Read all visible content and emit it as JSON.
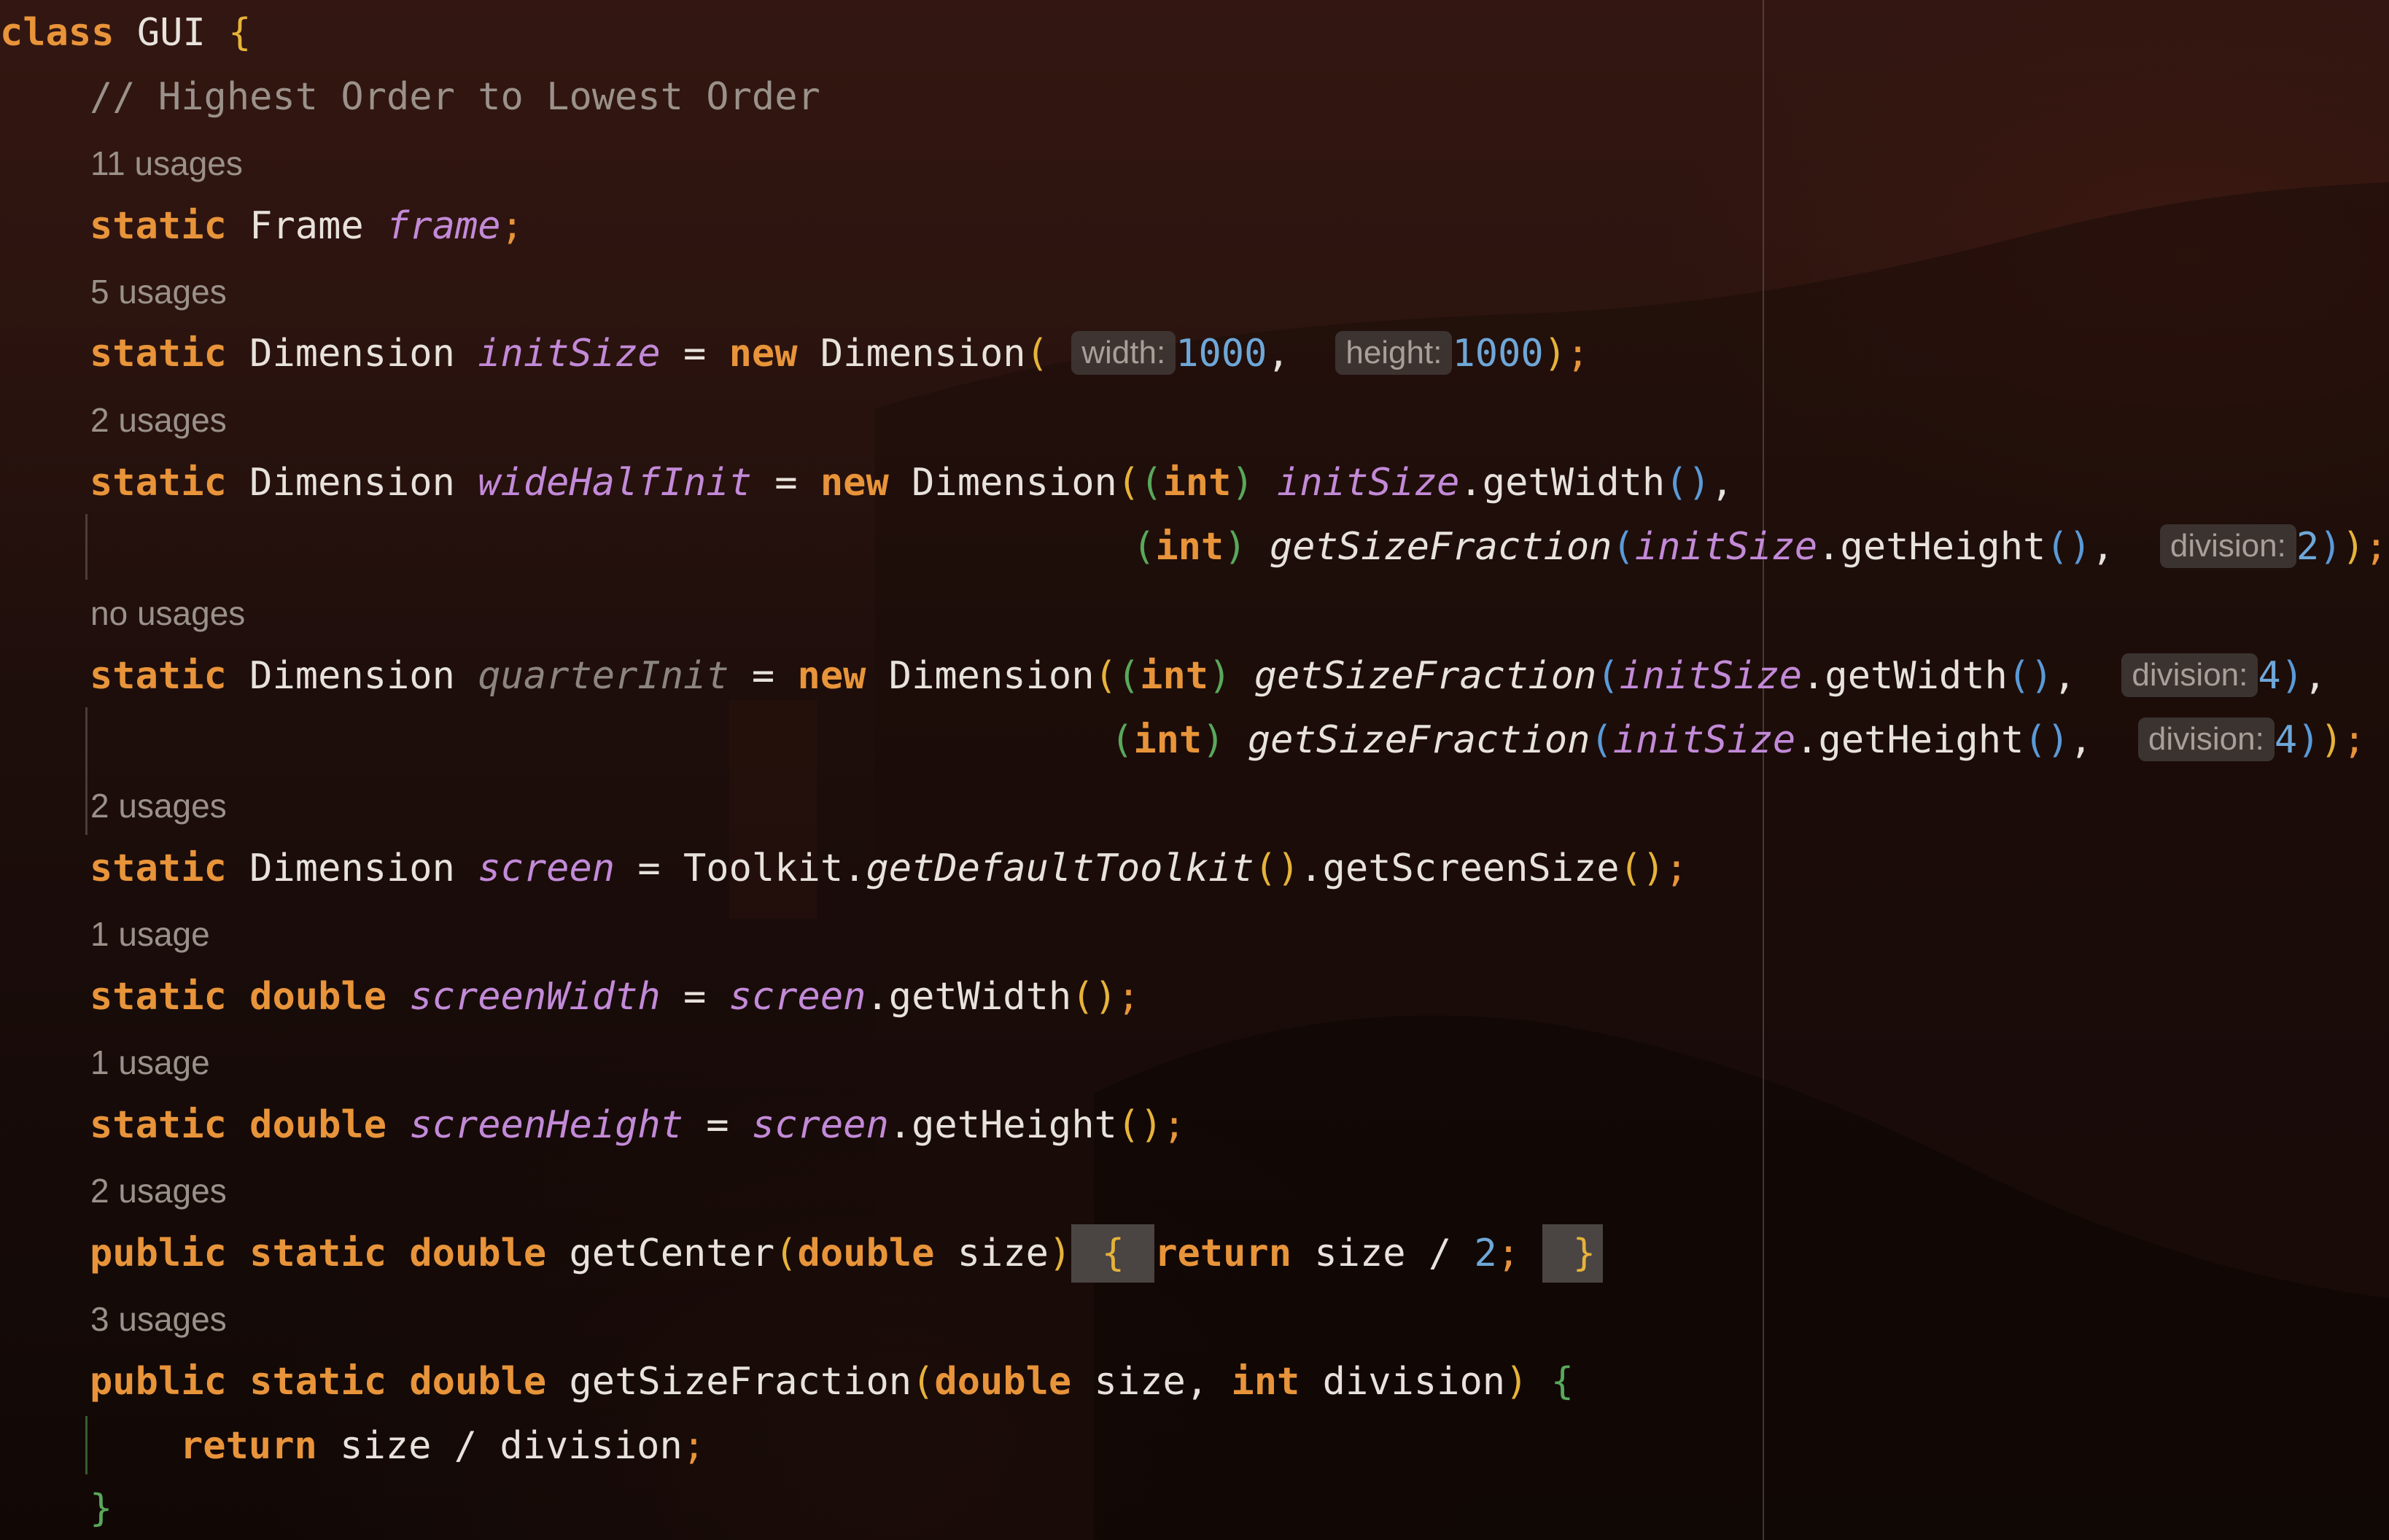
{
  "editor": {
    "class_line": {
      "kw": "class",
      "name": "GUI",
      "brace": "{"
    },
    "comment": "// Highest Order to Lowest Order",
    "usages": {
      "frame": "11 usages",
      "initSize": "5 usages",
      "wideHalfInit": "2 usages",
      "quarterInit": "no usages",
      "screen": "2 usages",
      "screenWidth": "1 usage",
      "screenHeight": "1 usage",
      "getCenter": "2 usages",
      "getSizeFraction": "3 usages"
    },
    "tokens": {
      "static": "static",
      "new": "new",
      "int": "int",
      "double": "double",
      "public": "public",
      "return": "return",
      "Frame": "Frame",
      "Dimension": "Dimension",
      "Toolkit": "Toolkit",
      "frame": "frame",
      "initSize": "initSize",
      "wideHalfInit": "wideHalfInit",
      "quarterInit": "quarterInit",
      "screen": "screen",
      "screenWidth": "screenWidth",
      "screenHeight": "screenHeight",
      "getWidth": "getWidth",
      "getHeight": "getHeight",
      "getSizeFraction": "getSizeFraction",
      "getDefaultToolkit": "getDefaultToolkit",
      "getScreenSize": "getScreenSize",
      "getCenter": "getCenter",
      "size": "size",
      "division": "division"
    },
    "hints": {
      "width": "width:",
      "height": "height:",
      "division": "division:"
    },
    "numbers": {
      "n1000": "1000",
      "n2": "2",
      "n4": "4"
    },
    "closing_brace": "}"
  }
}
